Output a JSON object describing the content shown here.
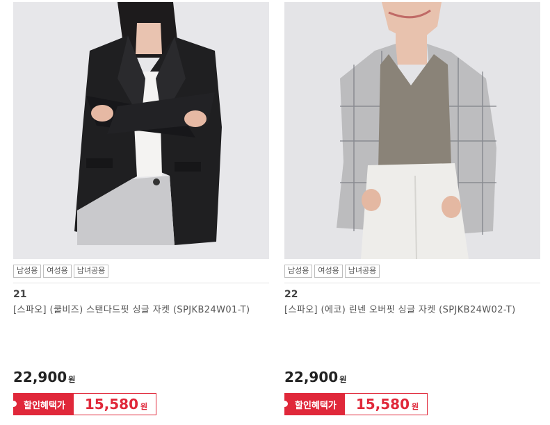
{
  "products": [
    {
      "tags": [
        "남성용",
        "여성용",
        "남녀공용"
      ],
      "rank": "21",
      "name": "[스파오] (쿨비즈) 스탠다드핏 싱글 자켓 (SPJKB24W01-T)",
      "price": "22,900",
      "price_unit": "원",
      "benefit_label": "할인혜택가",
      "sale_price": "15,580",
      "sale_unit": "원",
      "image": "woman-black-blazer-photo"
    },
    {
      "tags": [
        "남성용",
        "여성용",
        "남녀공용"
      ],
      "rank": "22",
      "name": "[스파오] (에코) 린넨 오버핏 싱글 자켓 (SPJKB24W02-T)",
      "price": "22,900",
      "price_unit": "원",
      "benefit_label": "할인혜택가",
      "sale_price": "15,580",
      "sale_unit": "원",
      "image": "woman-check-blazer-photo"
    }
  ],
  "colors": {
    "accent": "#e0283a",
    "photo_bg": "#e6e6e8"
  }
}
